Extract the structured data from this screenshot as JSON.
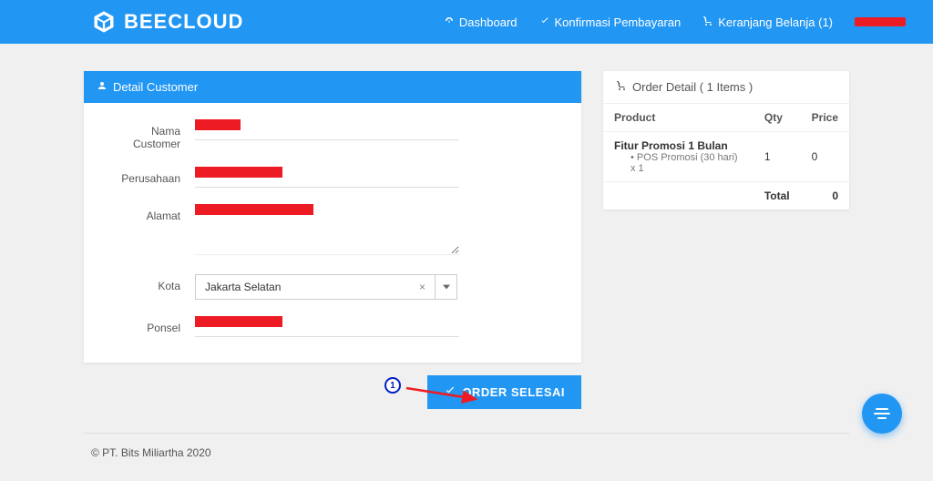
{
  "brand": "BEECLOUD",
  "nav": {
    "dashboard": "Dashboard",
    "konfirmasi": "Konfirmasi Pembayaran",
    "cart": "Keranjang Belanja (1)"
  },
  "customer_panel": {
    "title": "Detail Customer",
    "labels": {
      "nama": "Nama Customer",
      "perusahaan": "Perusahaan",
      "alamat": "Alamat",
      "kota": "Kota",
      "ponsel": "Ponsel"
    },
    "values": {
      "nama": "",
      "perusahaan": "",
      "alamat": "",
      "kota": "Jakarta Selatan",
      "ponsel": ""
    }
  },
  "order_panel": {
    "title": "Order Detail ( 1 Items )",
    "columns": {
      "product": "Product",
      "qty": "Qty",
      "price": "Price"
    },
    "item": {
      "name": "Fitur Promosi 1 Bulan",
      "sub": "POS Promosi (30 hari) x 1",
      "qty": "1",
      "price": "0"
    },
    "total_label": "Total",
    "total_value": "0"
  },
  "submit_label": "ORDER SELESAI",
  "annotation_badge": "1",
  "footer": "© PT. Bits Miliartha 2020"
}
